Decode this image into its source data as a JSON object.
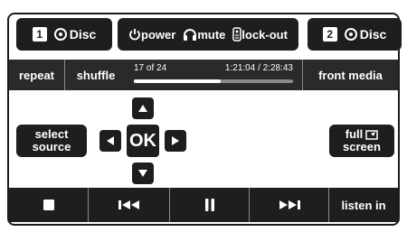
{
  "source1": {
    "number": "1",
    "label": "Disc"
  },
  "controls": {
    "power": "power",
    "mute": "mute",
    "lockout": "lock-out"
  },
  "source2": {
    "number": "2",
    "label": "Disc"
  },
  "toolbar": {
    "repeat": "repeat",
    "shuffle": "shuffle",
    "front_media": "front media"
  },
  "track": {
    "position": "17 of 24",
    "time": "1:21:04 / 2:28:43",
    "progress_fraction": 0.545
  },
  "select_source": [
    "select",
    "source"
  ],
  "ok": "OK",
  "full_screen": [
    "full",
    "screen"
  ],
  "transport": {
    "listen_in": "listen in"
  },
  "colors": {
    "button": "#1e1e1e",
    "text": "#ffffff",
    "divider": "#8a8a8a"
  }
}
